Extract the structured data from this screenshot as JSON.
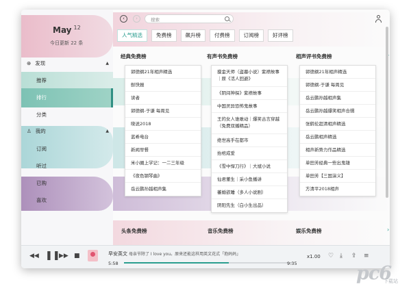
{
  "sidebar": {
    "month": "May",
    "day": "12",
    "update_text": "今日更新 22 条",
    "discover": {
      "label": "发现",
      "icon": "compass-icon"
    },
    "discover_items": [
      {
        "label": "推荐"
      },
      {
        "label": "排行",
        "active": true
      },
      {
        "label": "分类"
      }
    ],
    "mine": {
      "label": "我的",
      "icon": "user-icon"
    },
    "mine_items": [
      {
        "label": "订阅"
      },
      {
        "label": "听过"
      },
      {
        "label": "已购"
      },
      {
        "label": "喜欢"
      }
    ]
  },
  "topbar": {
    "search_placeholder": "搜索",
    "back_icon": "back-arrow-icon",
    "forward_icon": "forward-arrow-icon",
    "user_icon": "user-icon"
  },
  "tabs": [
    {
      "label": "人气精选",
      "active": true
    },
    {
      "label": "免费榜"
    },
    {
      "label": "飙升榜"
    },
    {
      "label": "付费榜"
    },
    {
      "label": "订阅榜"
    },
    {
      "label": "好评榜"
    }
  ],
  "columns": [
    {
      "title": "经典免费榜",
      "items": [
        "郭德纲21年相声精选",
        "鲜快报",
        "读者",
        "郭德纲-于谦 每周见",
        "晓说2018",
        "蓝希电台",
        "新闻早餐",
        "米小圈上学记：一二三年级",
        "《夜色钢琴曲》",
        "岳云鹏孙越相声集"
      ]
    },
    {
      "title": "有声书免费榜",
      "items": [
        "摸金天师（盗墓小说）紫襟故事｜原《活人回避》",
        "《阴间神探》紫襟故事",
        "中国灵异恐怖鬼故事",
        "王的女人谁敢动｜爆笑古言穿越（免费双播精品）",
        "绝世高手在都市",
        "抬棺成爱",
        "《雪中悍刀行》｜大斌小说",
        "仙君董生｜采小鱼播讲",
        "蕃婚欲睡（多人小说剧）",
        "阴阳先生（白小生出品）"
      ]
    },
    {
      "title": "相声评书免费榜",
      "items": [
        "郭德纲21年相声精选",
        "郭德纲-于谦 每周见",
        "岳云鹏孙越相声集",
        "岳云鹏孙越爆笑相声合辑",
        "张鹤伦超清相声精选",
        "岳云鹏相声精选",
        "相声新势力作品精选",
        "单田芳经典一些出鬼雄",
        "单田芳【三国演义】",
        "方清平2018相声"
      ]
    }
  ],
  "bottom_columns": [
    {
      "title": "头条免费榜"
    },
    {
      "title": "音乐免费榜"
    },
    {
      "title": "娱乐免费榜"
    }
  ],
  "player": {
    "title": "早安英文",
    "subtitle": "母亲节除了 I love you。原来还能这样用英文花式「抱妈妈」",
    "current_time": "5:58",
    "total_time": "9:35",
    "progress": 0.62,
    "speed": "x1.00",
    "prev_icon": "rewind-icon",
    "pause_icon": "pause-icon",
    "next_icon": "fast-forward-icon",
    "stop_icon": "stop-icon",
    "like_icon": "heart-icon",
    "download_icon": "download-icon",
    "share_icon": "share-icon",
    "playlist_icon": "playlist-icon"
  },
  "watermark": {
    "text": "pc6",
    "subtext": "下载站"
  }
}
